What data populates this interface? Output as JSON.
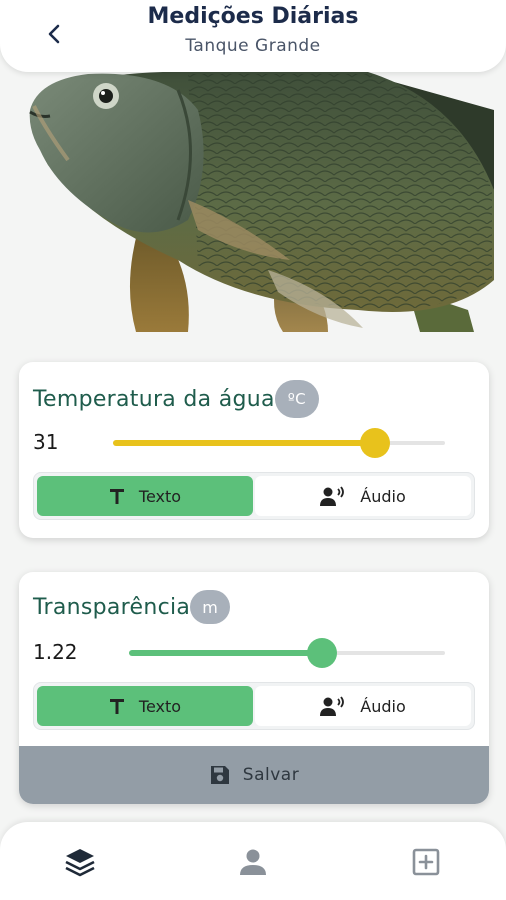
{
  "header": {
    "title": "Medições Diárias",
    "subtitle": "Tanque Grande",
    "back_icon": "chevron-left-icon"
  },
  "temperature": {
    "label": "Temperatura da água",
    "unit": "ºC",
    "value": "31",
    "slider_fraction": 0.79,
    "color": "#e8c21c",
    "text_tab": "Texto",
    "audio_tab": "Áudio",
    "selected_tab": "Texto"
  },
  "transparency": {
    "label": "Transparência",
    "unit": "m",
    "value": "1.22",
    "slider_fraction": 0.61,
    "color": "#5cc07a",
    "text_tab": "Texto",
    "audio_tab": "Áudio",
    "selected_tab": "Texto"
  },
  "save": {
    "label": "Salvar",
    "icon": "floppy-disk-icon"
  },
  "bottom_nav": {
    "items": [
      {
        "icon": "layers-icon",
        "active": true
      },
      {
        "icon": "person-icon",
        "active": false
      },
      {
        "icon": "add-square-icon",
        "active": false
      }
    ]
  },
  "colors": {
    "accent_green": "#5cc07a",
    "title_green": "#1f5c4c",
    "badge_gray": "#a8b0ba",
    "save_gray": "#939da6"
  }
}
